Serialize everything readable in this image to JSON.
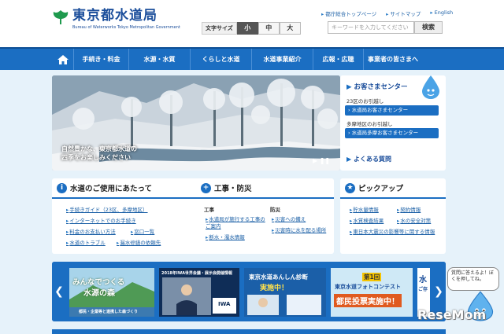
{
  "header": {
    "logo_jp": "東京都水道局",
    "logo_en": "Bureau of Waterworks Tokyo Metropolitan Government",
    "links": [
      "都庁総合トップページ",
      "サイトマップ",
      "English"
    ],
    "fontsize_label": "文字サイズ",
    "fontsize_options": [
      "小",
      "中",
      "大"
    ],
    "search_placeholder": "キーワードを入力してください",
    "search_button": "検索"
  },
  "nav": {
    "items": [
      "手続き・料金",
      "水源・水質",
      "くらしと水道",
      "水道事業紹介",
      "広報・広聴",
      "事業者の皆さまへ"
    ]
  },
  "hero": {
    "caption_line1": "自然豊かな、東京都水道の",
    "caption_line2": "四季をお楽しみください"
  },
  "customer_center": {
    "title": "お客さまセンター",
    "area1": "23区のお引越し",
    "button1": "水道局お客さまセンター",
    "area2": "多摩地区のお引越し",
    "button2": "水道局多摩お客さまセンター",
    "faq": "よくある質問"
  },
  "box_water": {
    "title": "水道のご使用にあたって",
    "links": [
      "手続きガイド（23区、多摩地区）",
      "インターネットでのお手続き",
      "料金のお支払い方法",
      "窓口一覧",
      "水道のトラブル",
      "漏水修繕の依頼先"
    ]
  },
  "box_works": {
    "title": "工事・防災",
    "col1_heading": "工事",
    "col1_links": [
      "水道局が施行する工事のご案内",
      "断水・濁水情報"
    ],
    "col2_heading": "防災",
    "col2_links": [
      "災害への備え",
      "災害時に水を配る場所"
    ]
  },
  "box_pickup": {
    "title": "ピックアップ",
    "links": [
      "貯水量情報",
      "契約情報",
      "水質検査結果",
      "水の安全対策",
      "東日本大震災の影響等に関する情報"
    ]
  },
  "banners": {
    "b1_line1": "みんなでつくる",
    "b1_line2": "水源の森",
    "b1_line3": "都民・企業等と連携した森づくり",
    "b2_line1": "2018年IWA世界会議・展示会開催情報",
    "b2_line2": "IWA",
    "b3_line1": "東京水道あんしん診断",
    "b3_line2": "実施中！",
    "b4_line1": "第1回",
    "b4_line2": "東京水道フォトコンテスト",
    "b4_line3": "都民投票実施中！",
    "b5_line1": "水",
    "b5_line2": "ご存"
  },
  "mascot": {
    "speech": "質問に答えるよ！ぼくを押してね。"
  },
  "watermark": "ReseMom"
}
